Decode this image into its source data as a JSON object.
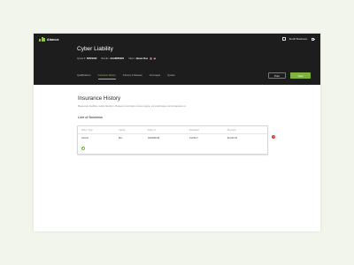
{
  "app": {
    "brand": "Abacus",
    "account_label": "Small Business"
  },
  "header": {
    "title": "Cyber Liability",
    "quote_label": "Quote #:",
    "quote_value": "65521222",
    "bundle_label": "Bundle:",
    "bundle_value": "AAA8855222",
    "client_label": "Client:",
    "client_value": "James Doe",
    "alert_badge": "!"
  },
  "tabs": [
    {
      "label": "Qualifications",
      "active": false
    },
    {
      "label": "Insurance History",
      "active": true
    },
    {
      "label": "Industry & Release",
      "active": false
    },
    {
      "label": "Coverages",
      "active": false
    },
    {
      "label": "Quotes",
      "active": false
    }
  ],
  "actions": {
    "prior_label": "Prior",
    "next_label": "Next"
  },
  "main": {
    "heading": "Insurance History",
    "description": "Maecenas faucibus mollis interdum. Praesent commodo cursus magna, vel scelerisque nisl consectetur et.",
    "section_label": "Line of Business"
  },
  "table": {
    "columns": [
      "Policy Type",
      "Carrier",
      "Policy #",
      "Expiration",
      "Premium"
    ],
    "rows": [
      [
        "Admitd",
        "Box",
        "00026BC96",
        "01/25/17",
        "$2,000.00"
      ]
    ],
    "remove_label": "!"
  },
  "colors": {
    "accent": "#7eb23b",
    "header_bg": "#1d1d1d",
    "danger": "#d23b2e",
    "page_bg": "#f1f5ec"
  }
}
